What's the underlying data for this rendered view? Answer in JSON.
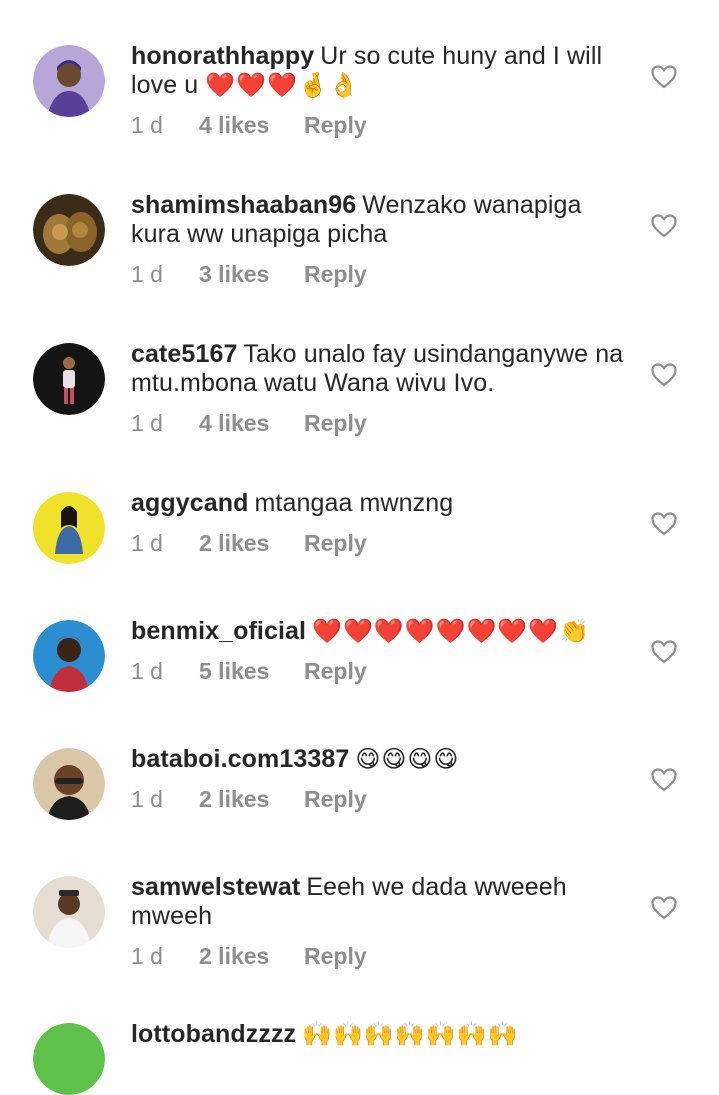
{
  "comments": [
    {
      "username": "honorathhappy",
      "text": "Ur so cute huny and I will love u",
      "emoji": "❤️❤️❤️🤞👌",
      "time": "1 d",
      "likes": "4 likes",
      "reply": "Reply",
      "avatar_color": "#6b5aa8"
    },
    {
      "username": "shamimshaaban96",
      "text": "Wenzako wanapiga kura ww unapiga picha",
      "emoji": "",
      "time": "1 d",
      "likes": "3 likes",
      "reply": "Reply",
      "avatar_color": "#7a5a2e"
    },
    {
      "username": "cate5167",
      "text": "Tako unalo fay usindanganywe na mtu.mbona watu Wana wivu Ivo.",
      "emoji": "",
      "time": "1 d",
      "likes": "4 likes",
      "reply": "Reply",
      "avatar_color": "#1e1e1e"
    },
    {
      "username": "aggycand",
      "text": "mtangaa mwnzng",
      "emoji": "",
      "time": "1 d",
      "likes": "2 likes",
      "reply": "Reply",
      "avatar_color": "#f2e22c"
    },
    {
      "username": "benmix_oficial",
      "text": "",
      "emoji": "❤️❤️❤️❤️❤️❤️❤️❤️👏",
      "time": "1 d",
      "likes": "5 likes",
      "reply": "Reply",
      "avatar_color": "#2f86c8"
    },
    {
      "username": "bataboi.com13387",
      "text": "",
      "emoji": "😋😋😋😋",
      "time": "1 d",
      "likes": "2 likes",
      "reply": "Reply",
      "avatar_color": "#8a6a3a"
    },
    {
      "username": "samwelstewat",
      "text": "Eeeh we dada wweeeh mweeh",
      "emoji": "",
      "time": "1 d",
      "likes": "2 likes",
      "reply": "Reply",
      "avatar_color": "#c9b9a6"
    },
    {
      "username": "lottobandzzzz",
      "text": "",
      "emoji": "🙌🙌🙌🙌🙌🙌🙌",
      "time": "",
      "likes": "",
      "reply": "",
      "avatar_color": "#5ec14a"
    }
  ],
  "icons": {
    "like": "heart-outline-icon"
  }
}
